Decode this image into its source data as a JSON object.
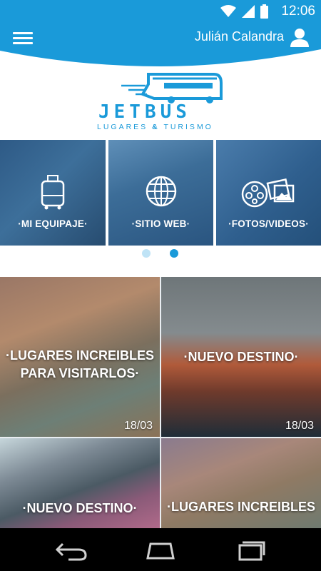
{
  "status_bar": {
    "time": "12:06"
  },
  "app_bar": {
    "user_name": "Julián Calandra"
  },
  "logo": {
    "brand": "JETBUS",
    "tagline_part1": "LUGARES",
    "tagline_amp": "&",
    "tagline_part2": "TURISMO"
  },
  "carousel": {
    "tiles": [
      {
        "label": "·MI EQUIPAJE·",
        "icon": "luggage-icon"
      },
      {
        "label": "·SITIO WEB·",
        "icon": "globe-icon"
      },
      {
        "label": "·FOTOS/VIDEOS·",
        "icon": "photos-videos-icon"
      }
    ],
    "active_page": 2,
    "page_count": 2
  },
  "cards": [
    {
      "title": "·LUGARES INCREIBLES PARA VISITARLOS·",
      "date": "18/03"
    },
    {
      "title": "·NUEVO DESTINO·",
      "date": "18/03"
    },
    {
      "title": "·NUEVO DESTINO·",
      "date": ""
    },
    {
      "title": "·LUGARES INCREIBLES",
      "date": ""
    }
  ],
  "colors": {
    "accent": "#1a9ad9",
    "dot_inactive": "#bfe3f6",
    "nav_background": "#000000"
  }
}
